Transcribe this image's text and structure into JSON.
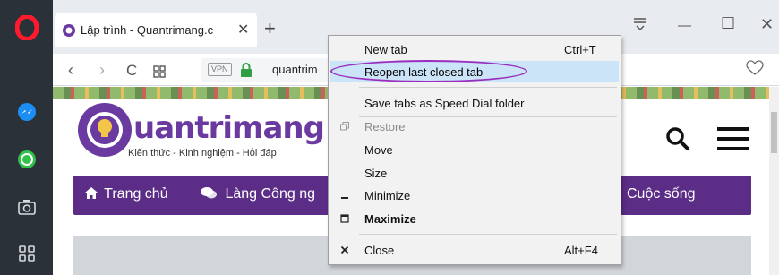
{
  "tab": {
    "title": "Lập trình - Quantrimang.c",
    "close_label": "✕",
    "new_tab_label": "+"
  },
  "address_bar": {
    "vpn_label": "VPN",
    "url": "quantrim"
  },
  "window_controls": {
    "minimize": "—",
    "maximize": "☐",
    "close": "✕"
  },
  "site": {
    "logo_text": "uantrimang",
    "tagline": "Kiến thức - Kinh nghiệm - Hỏi đáp",
    "nav": [
      "Trang chủ",
      "Làng Công ng",
      "Cuộc sống"
    ],
    "watermark": "uantrimang"
  },
  "context_menu": {
    "items": [
      {
        "label": "New tab",
        "shortcut": "Ctrl+T",
        "icon": "",
        "state": "normal"
      },
      {
        "label": "Reopen last closed tab",
        "shortcut": "",
        "icon": "",
        "state": "highlighted"
      },
      {
        "label": "Save tabs as Speed Dial folder",
        "shortcut": "",
        "icon": "",
        "state": "normal"
      },
      {
        "label": "Restore",
        "shortcut": "",
        "icon": "restore-icon",
        "state": "disabled"
      },
      {
        "label": "Move",
        "shortcut": "",
        "icon": "",
        "state": "normal"
      },
      {
        "label": "Size",
        "shortcut": "",
        "icon": "",
        "state": "normal"
      },
      {
        "label": "Minimize",
        "shortcut": "",
        "icon": "minimize-icon",
        "state": "normal"
      },
      {
        "label": "Maximize",
        "shortcut": "",
        "icon": "maximize-icon",
        "state": "bold"
      },
      {
        "label": "Close",
        "shortcut": "Alt+F4",
        "icon": "close-icon",
        "state": "normal"
      }
    ]
  },
  "colors": {
    "highlight": "#cce4f7",
    "annotation_oval": "#9a2fbf",
    "site_purple": "#5b2d86",
    "sidebar": "#2b3138"
  }
}
